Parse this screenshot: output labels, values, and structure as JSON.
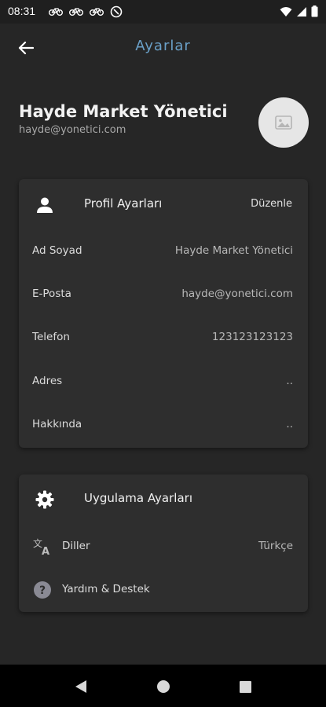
{
  "status_bar": {
    "time": "08:31",
    "left_icons": [
      "bike-icon",
      "bike-icon",
      "bike-icon",
      "no-disturb-icon"
    ],
    "right_icons": [
      "wifi-icon",
      "signal-icon",
      "battery-icon"
    ]
  },
  "app_bar": {
    "title": "Ayarlar",
    "back_icon": "arrow-left-icon",
    "title_color": "#6aa0c8"
  },
  "profile": {
    "name": "Hayde Market Yönetici",
    "email": "hayde@yonetici.com",
    "avatar_icon": "image-placeholder-icon"
  },
  "profile_card": {
    "icon": "person-icon",
    "title": "Profil Ayarları",
    "action": "Düzenle",
    "rows": [
      {
        "label": "Ad Soyad",
        "value": "Hayde Market Yönetici"
      },
      {
        "label": "E-Posta",
        "value": "hayde@yonetici.com"
      },
      {
        "label": "Telefon",
        "value": "123123123123"
      },
      {
        "label": "Adres",
        "value": ".."
      },
      {
        "label": "Hakkında",
        "value": ".."
      }
    ]
  },
  "app_card": {
    "icon": "gear-icon",
    "title": "Uygulama Ayarları",
    "rows": [
      {
        "icon": "translate-icon",
        "label": "Diller",
        "value": "Türkçe"
      },
      {
        "icon": "help-icon",
        "label": "Yardım & Destek",
        "value": ""
      }
    ]
  },
  "nav_bar": {
    "buttons": [
      "back-triangle-icon",
      "home-circle-icon",
      "recents-square-icon"
    ]
  }
}
